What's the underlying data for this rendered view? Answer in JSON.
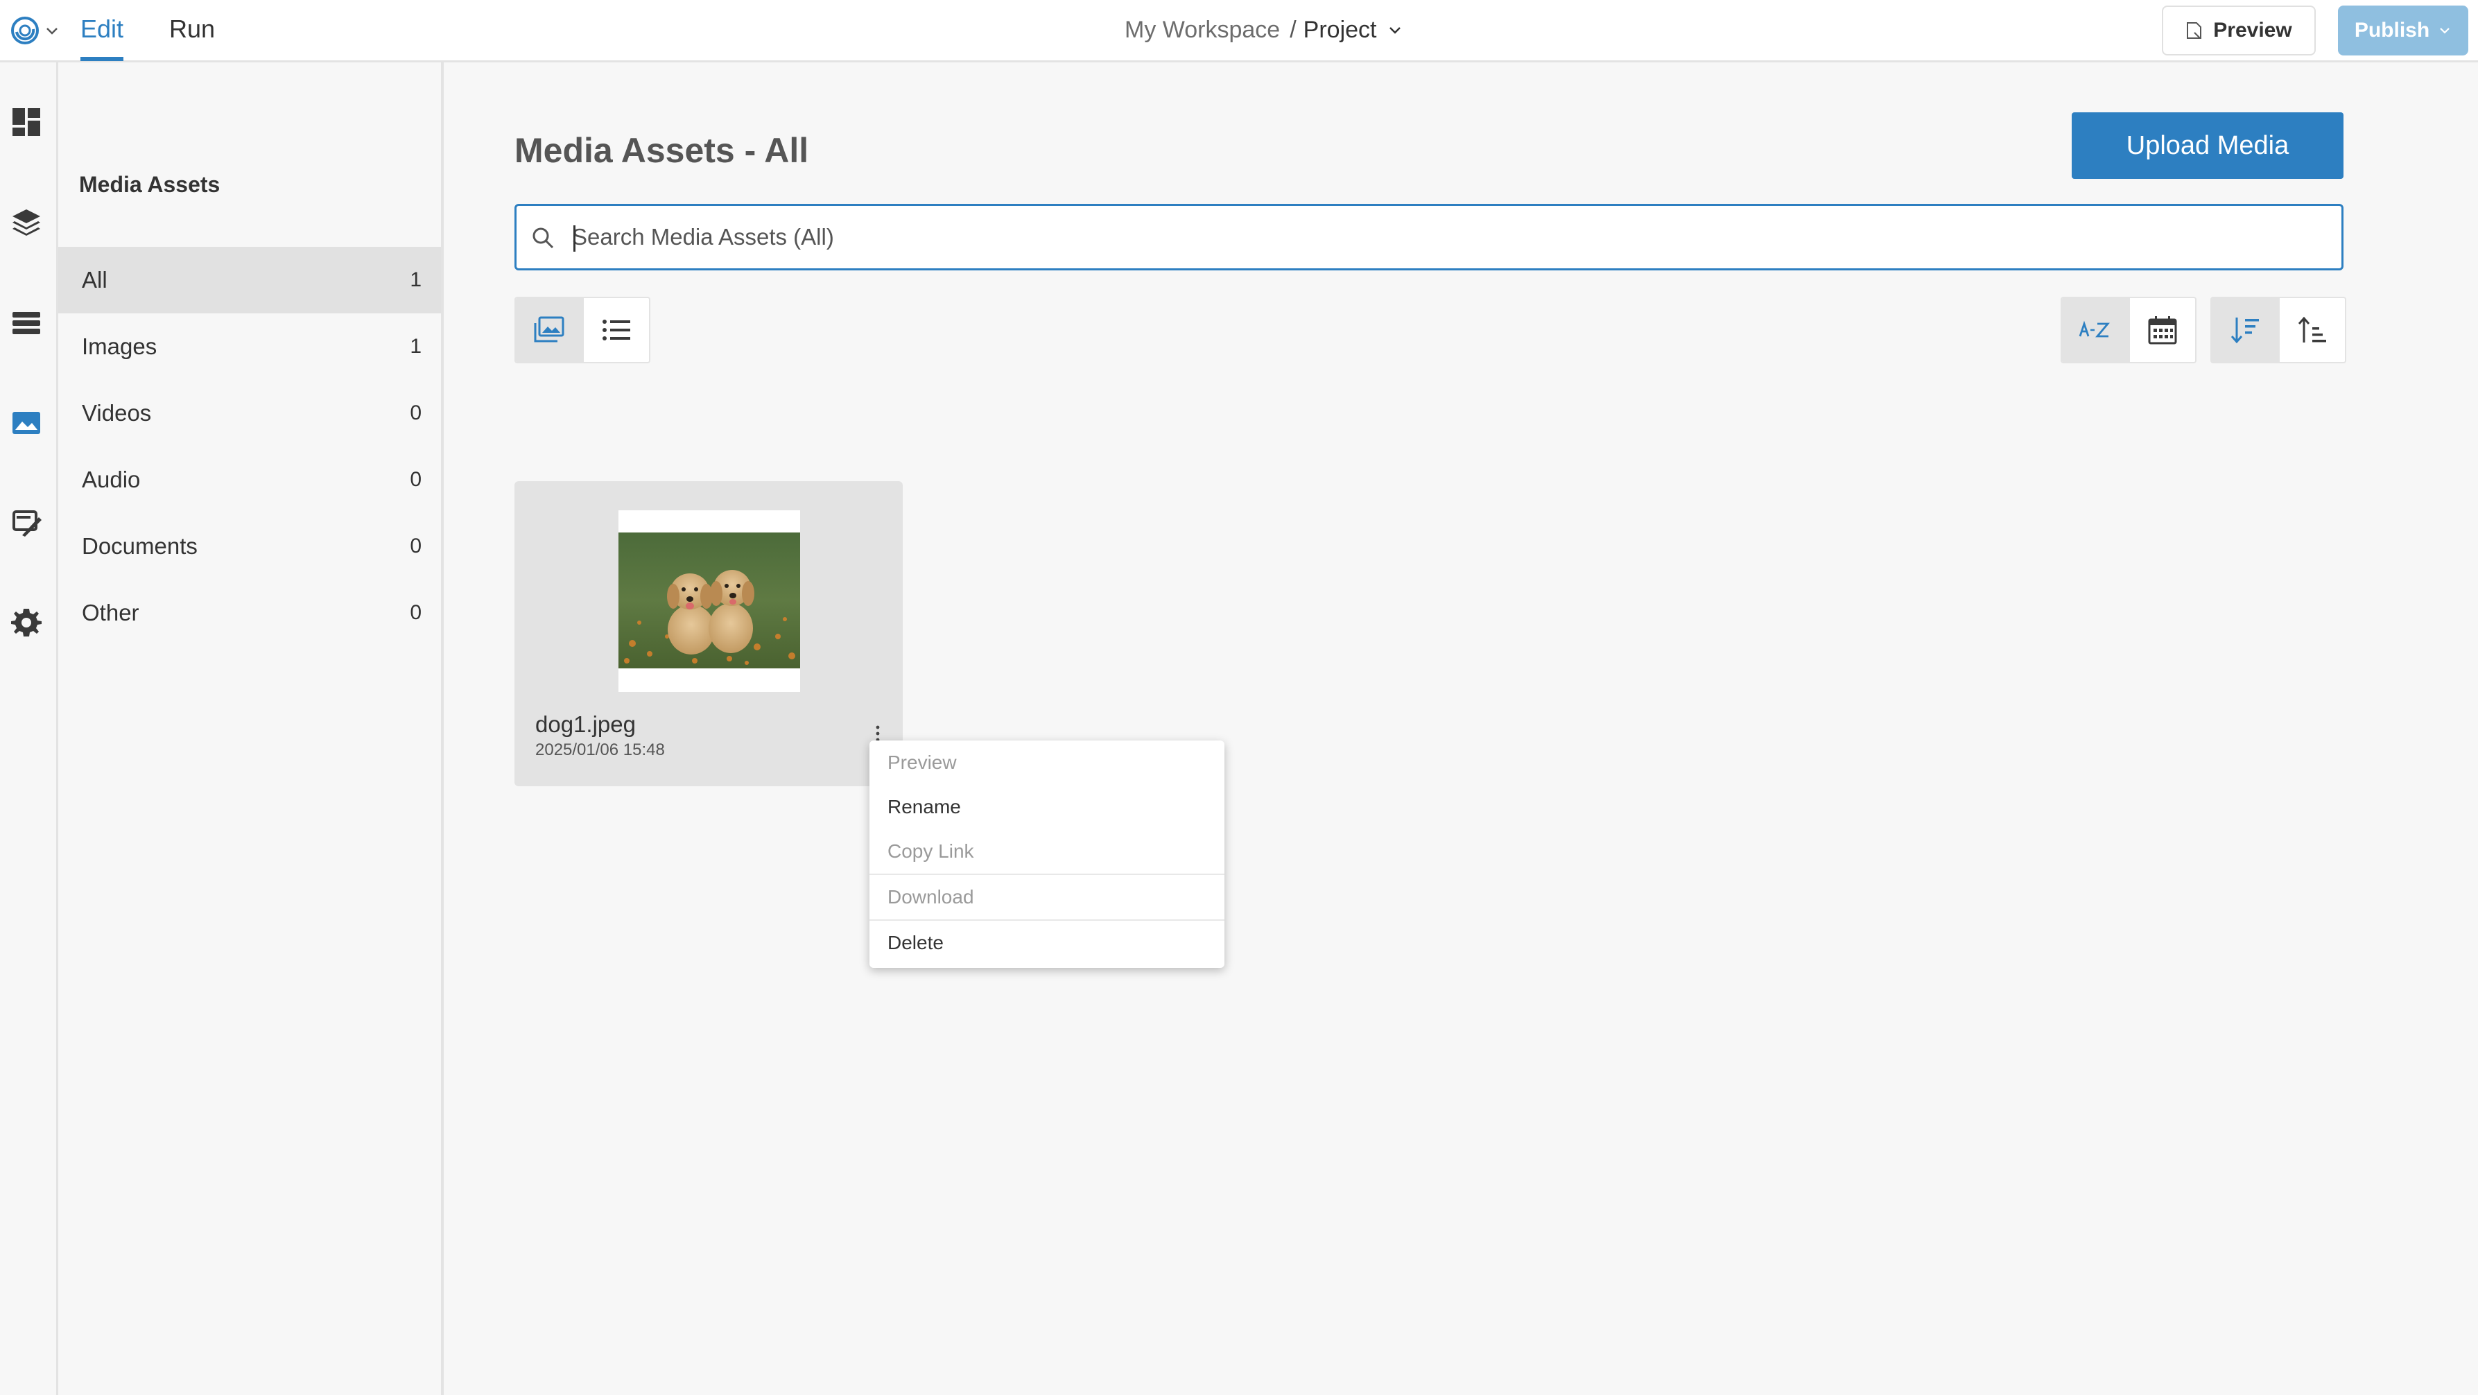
{
  "topbar": {
    "tabs": [
      {
        "label": "Edit",
        "active": true
      },
      {
        "label": "Run",
        "active": false
      }
    ],
    "breadcrumb": {
      "workspace": "My Workspace",
      "separator": "/",
      "project": "Project"
    },
    "preview_label": "Preview",
    "publish_label": "Publish"
  },
  "rail": {
    "icons": [
      "dashboard-icon",
      "layers-icon",
      "list-icon",
      "media-icon",
      "brush-icon",
      "gear-icon"
    ],
    "active": "media-icon"
  },
  "sidebar": {
    "title": "Media Assets",
    "categories": [
      {
        "label": "All",
        "count": "1",
        "active": true
      },
      {
        "label": "Images",
        "count": "1",
        "active": false
      },
      {
        "label": "Videos",
        "count": "0",
        "active": false
      },
      {
        "label": "Audio",
        "count": "0",
        "active": false
      },
      {
        "label": "Documents",
        "count": "0",
        "active": false
      },
      {
        "label": "Other",
        "count": "0",
        "active": false
      }
    ]
  },
  "main": {
    "title": "Media Assets - All",
    "upload_label": "Upload Media",
    "search_placeholder": "Search Media Assets (All)",
    "search_value": "",
    "view_mode": "grid",
    "sort_mode": "name",
    "sort_direction": "descending"
  },
  "assets": [
    {
      "name": "dog1.jpeg",
      "date": "2025/01/06 15:48",
      "thumbnail": "puppies-photo"
    }
  ],
  "context_menu": {
    "items": [
      {
        "label": "Preview",
        "enabled": false
      },
      {
        "label": "Rename",
        "enabled": true
      },
      {
        "label": "Copy Link",
        "enabled": false
      },
      {
        "label": "Download",
        "enabled": false
      },
      {
        "label": "Delete",
        "enabled": true
      }
    ]
  },
  "colors": {
    "accent": "#2d7fc1",
    "publish_disabled": "#8fbfe0",
    "selected_bg": "#e1e1e1",
    "background": "#f7f7f7"
  }
}
